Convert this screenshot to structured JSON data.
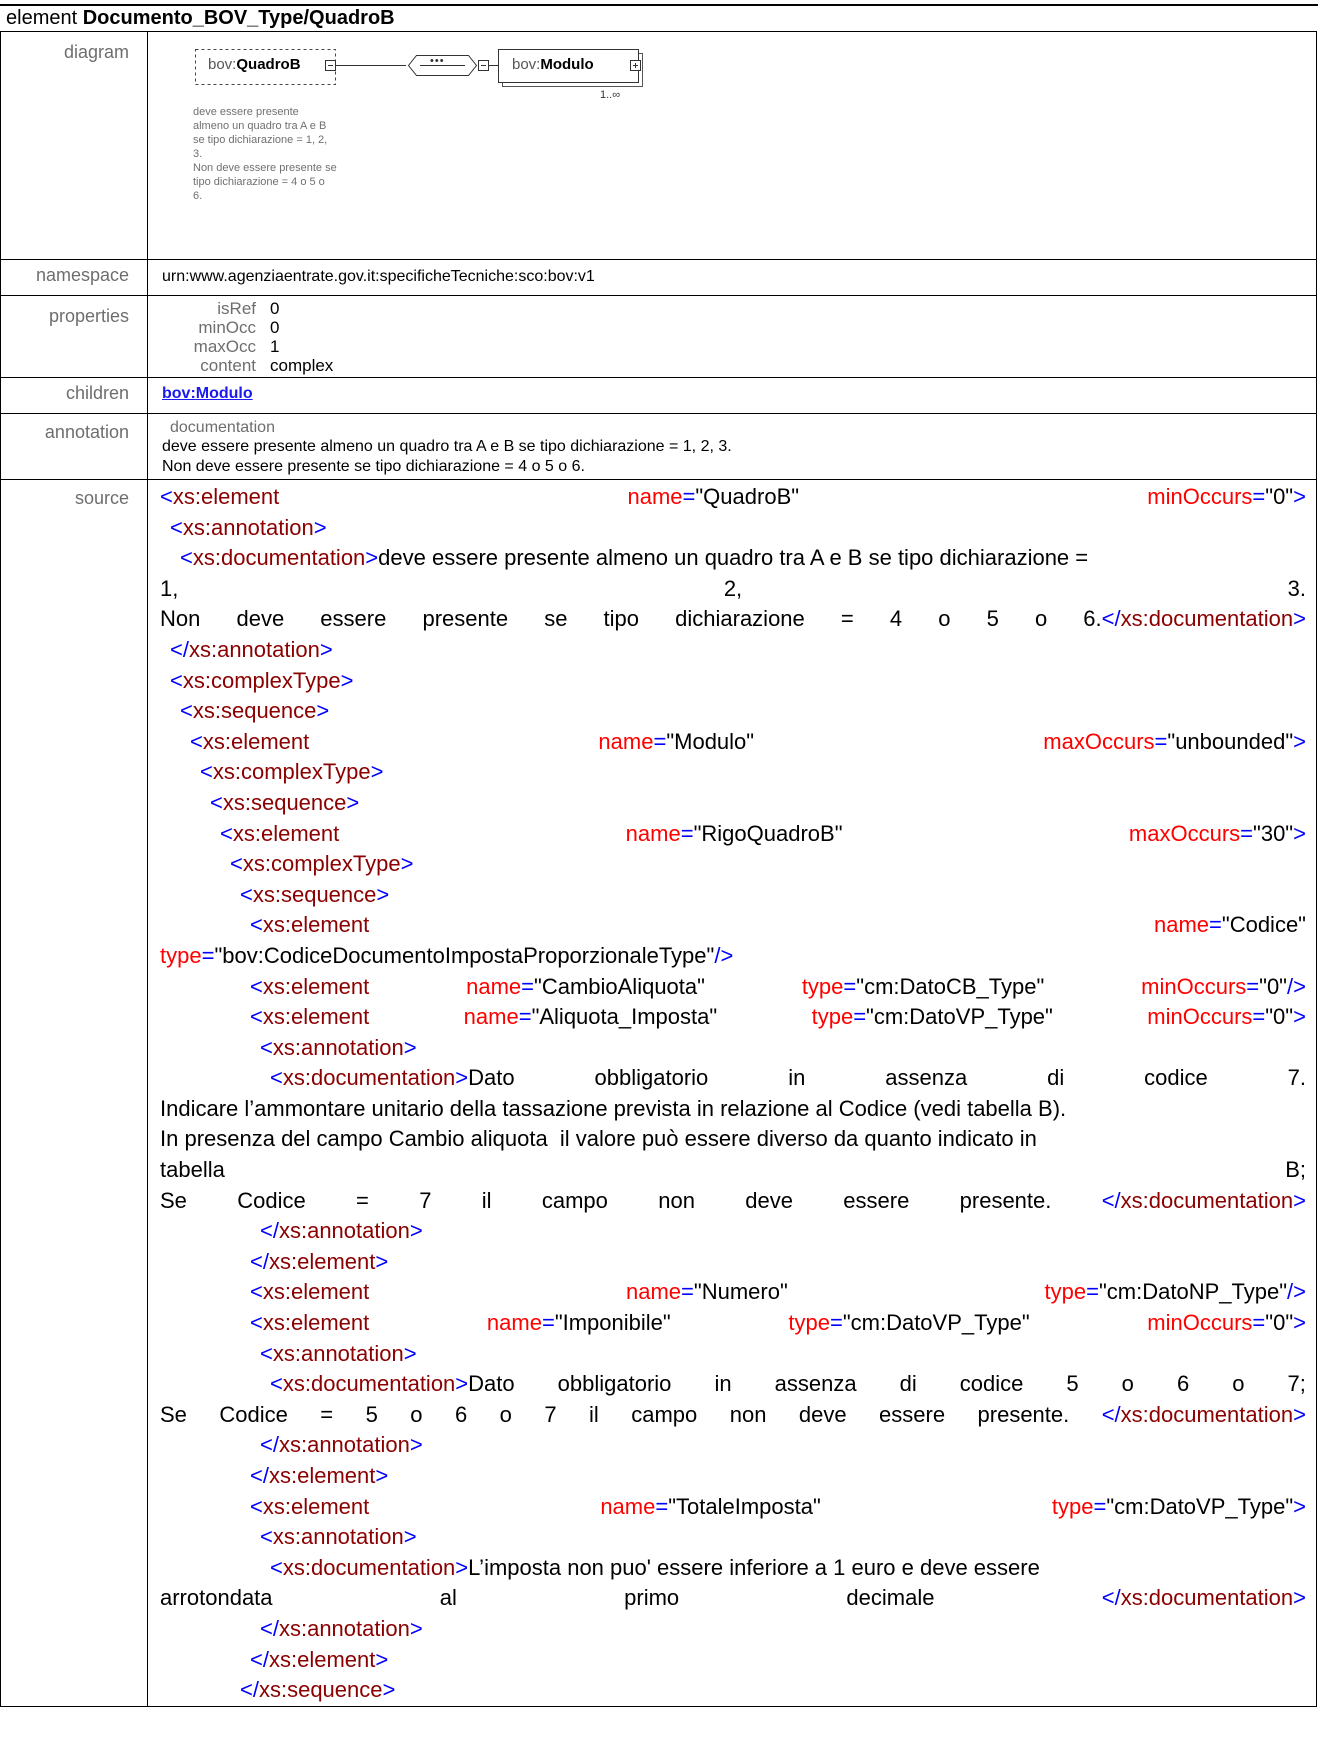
{
  "header": {
    "prefix": "element",
    "name": "Documento_BOV_Type/QuadroB"
  },
  "labels": {
    "diagram": "diagram",
    "namespace": "namespace",
    "properties": "properties",
    "children": "children",
    "annotation": "annotation",
    "source": "source"
  },
  "diagram": {
    "element_prefix": "bov:",
    "element_name": "QuadroB",
    "child_prefix": "bov:",
    "child_name": "Modulo",
    "sequence_symbol": "•••",
    "cardinality": "1..∞",
    "note_lines": [
      "deve essere presente",
      "almeno un quadro tra A e B",
      "se tipo dichiarazione = 1, 2,",
      "3.",
      "Non deve essere presente se",
      "tipo dichiarazione = 4 o 5 o",
      "6."
    ]
  },
  "namespace": "urn:www.agenziaentrate.gov.it:specificheTecniche:sco:bov:v1",
  "properties": [
    {
      "key": "isRef",
      "value": "0"
    },
    {
      "key": "minOcc",
      "value": "0"
    },
    {
      "key": "maxOcc",
      "value": "1"
    },
    {
      "key": "content",
      "value": "complex"
    }
  ],
  "children": [
    "bov:Modulo"
  ],
  "annotation": {
    "heading": "documentation",
    "lines": [
      "deve essere presente almeno un quadro tra A e B se tipo dichiarazione = 1, 2, 3.",
      "Non deve essere presente se tipo dichiarazione = 4 o 5 o 6."
    ]
  },
  "source_text": {
    "doc1_line1": "deve essere presente almeno un quadro tra A e B se tipo dichiarazione =",
    "doc1_nums": [
      "1,",
      "2,",
      "3."
    ],
    "doc1_line3_words": [
      "Non",
      "deve",
      "essere",
      "presente",
      "se",
      "tipo",
      "dichiarazione",
      "=",
      "4",
      "o",
      "5",
      "o",
      "6."
    ],
    "doc2_line1_words": [
      "Dato",
      "obbligatorio",
      "in",
      "assenza",
      "di",
      "codice",
      "7."
    ],
    "doc2_line2": "Indicare l’ammontare unitario della tassazione prevista in relazione al Codice (vedi tabella B).",
    "doc2_line3": "In presenza del campo Cambio aliquota  il valore può essere diverso da quanto indicato in",
    "doc2_line4_words": [
      "tabella",
      "B;"
    ],
    "doc2_line5_words": [
      "Se",
      "Codice",
      "=",
      "7",
      "il",
      "campo",
      "non",
      "deve",
      "essere",
      "presente."
    ],
    "doc3_line1_words": [
      "Dato",
      "obbligatorio",
      "in",
      "assenza",
      "di",
      "codice",
      "5",
      "o",
      "6",
      "o",
      "7;"
    ],
    "doc3_line2_words": [
      "Se",
      "Codice",
      "=",
      "5",
      "o",
      "6",
      "o",
      "7",
      "il",
      "campo",
      "non",
      "deve",
      "essere",
      "presente."
    ],
    "doc4_line1": "L’imposta non puo' essere inferiore a 1 euro e deve essere",
    "doc4_line2_words": [
      "arrotondata",
      "al",
      "primo",
      "decimale"
    ]
  },
  "source_tokens": {
    "xs_element": "xs:element",
    "xs_annotation": "xs:annotation",
    "xs_documentation": "xs:documentation",
    "xs_complexType": "xs:complexType",
    "xs_sequence": "xs:sequence",
    "attr_name": "name",
    "attr_minOccurs": "minOccurs",
    "attr_maxOccurs": "maxOccurs",
    "attr_type": "type",
    "val_QuadroB": "\"QuadroB\"",
    "val_0": "\"0\"",
    "val_Modulo": "\"Modulo\"",
    "val_unbounded": "\"unbounded\"",
    "val_RigoQuadroB": "\"RigoQuadroB\"",
    "val_30": "\"30\"",
    "val_Codice": "\"Codice\"",
    "val_CodiceType": "\"bov:CodiceDocumentoImpostaProporzionaleType\"",
    "val_CambioAliquota": "\"CambioAliquota\"",
    "val_DatoCB": "\"cm:DatoCB_Type\"",
    "val_Aliquota": "\"Aliquota_Imposta\"",
    "val_DatoVP": "\"cm:DatoVP_Type\"",
    "val_Numero": "\"Numero\"",
    "val_DatoNP": "\"cm:DatoNP_Type\"",
    "val_Imponibile": "\"Imponibile\"",
    "val_TotaleImposta": "\"TotaleImposta\""
  }
}
